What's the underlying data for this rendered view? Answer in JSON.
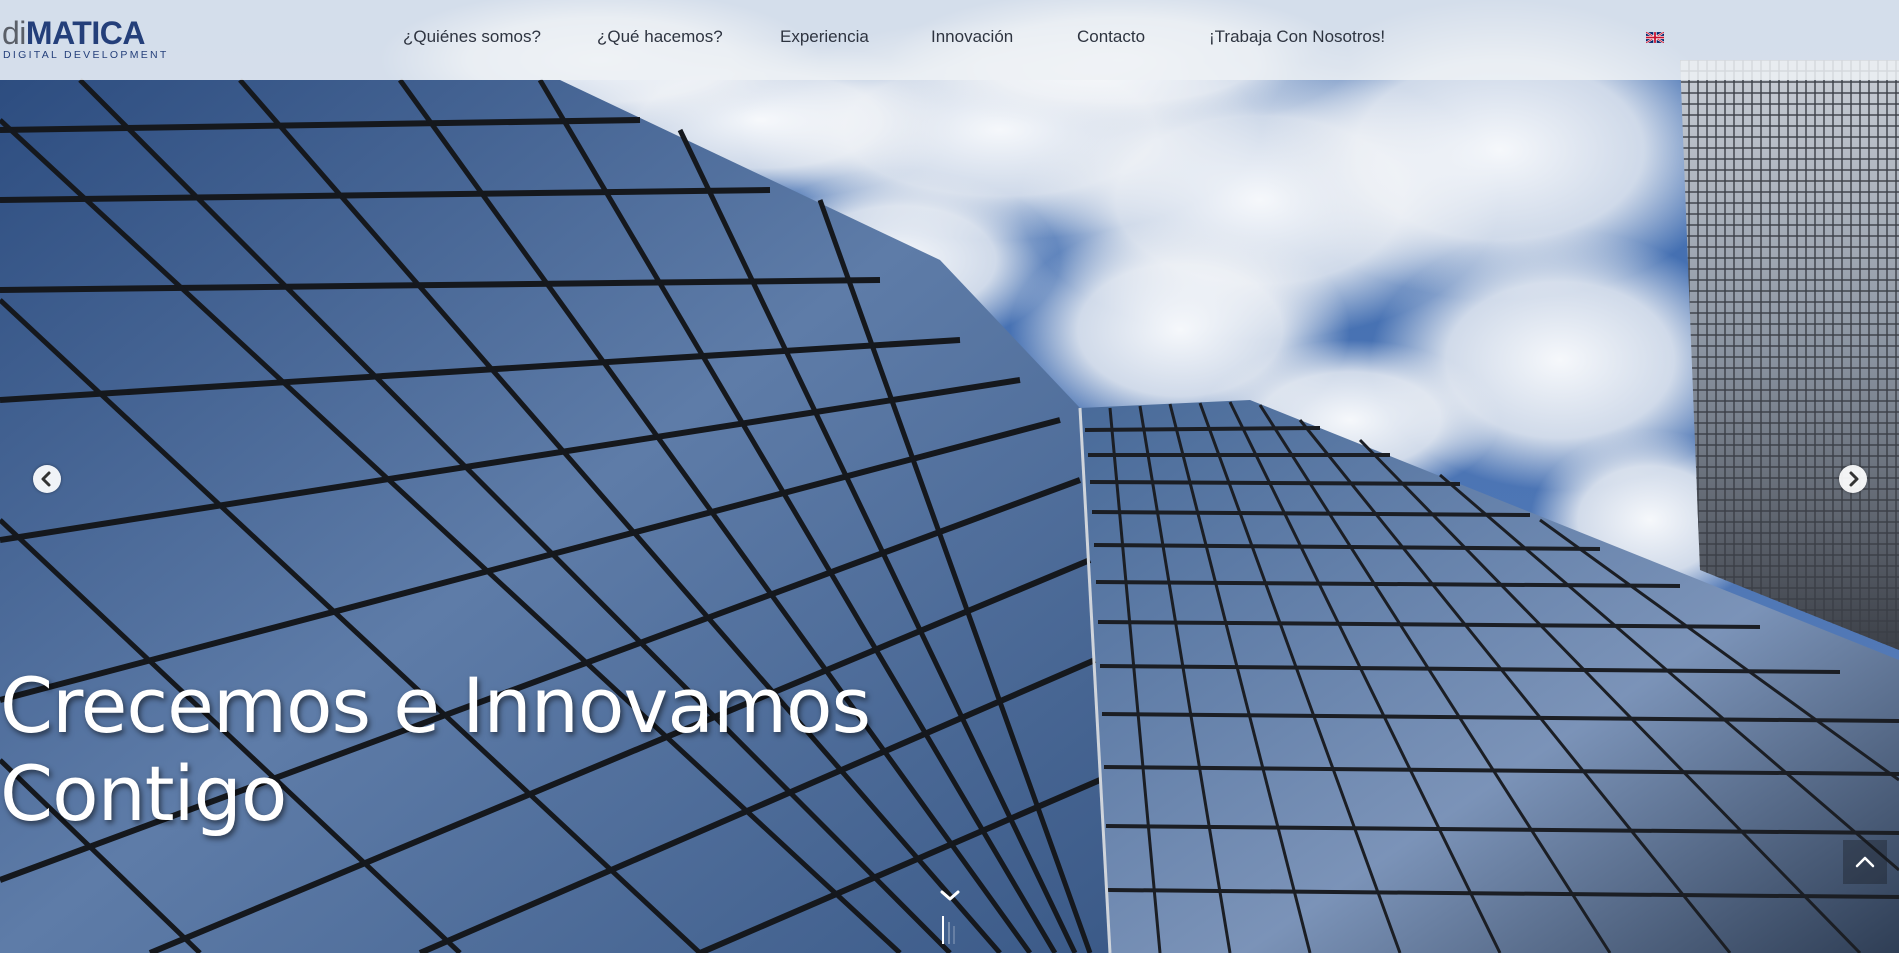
{
  "logo": {
    "prefix": "di",
    "name": "MATICA",
    "tagline": "DIGITAL DEVELOPMENT"
  },
  "nav": {
    "items": [
      {
        "label": "¿Quiénes somos?"
      },
      {
        "label": "¿Qué hacemos?"
      },
      {
        "label": "Experiencia"
      },
      {
        "label": "Innovación"
      },
      {
        "label": "Contacto"
      },
      {
        "label": "¡Trabaja Con Nosotros!"
      }
    ],
    "language_icon": "uk-flag-icon"
  },
  "hero": {
    "caption_line1": "Crecemos e Innovamos",
    "caption_line2": "Contigo"
  },
  "controls": {
    "prev_icon": "chevron-left-icon",
    "next_icon": "chevron-right-icon",
    "scroll_icon": "chevron-down-icon",
    "back_to_top_icon": "chevron-up-icon"
  },
  "colors": {
    "brand_blue": "#243f7a",
    "brand_gray": "#5a5f68",
    "nav_text": "#2e3440",
    "header_bg": "#eef1f5",
    "sky": "#6f88b0"
  }
}
